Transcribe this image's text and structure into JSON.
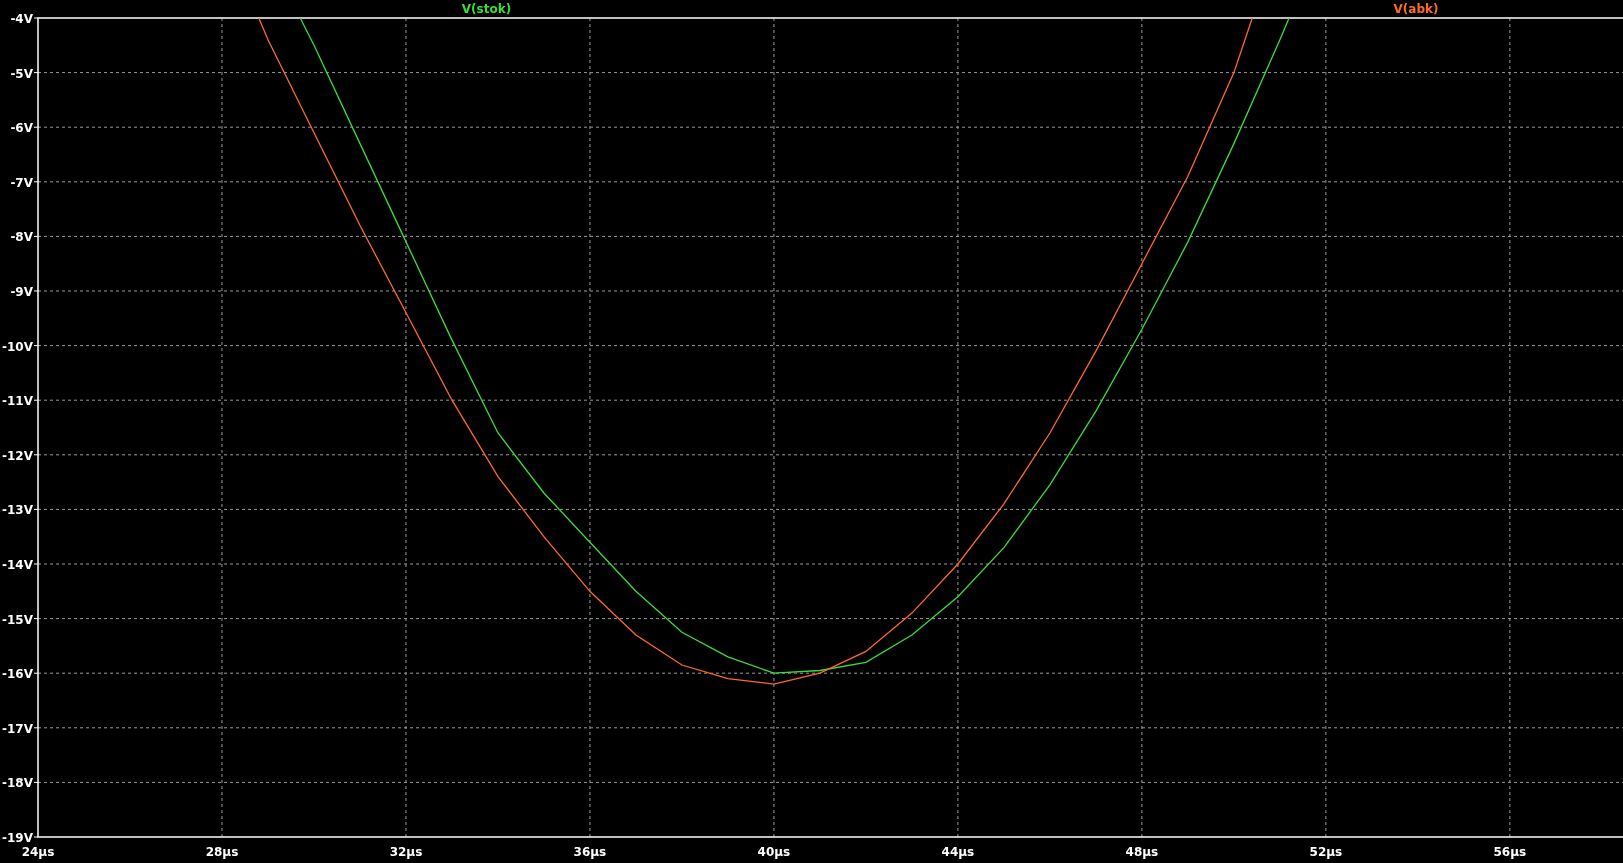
{
  "plot": {
    "chart_data": {
      "type": "line",
      "grid": true,
      "xlim": [
        24,
        58.46
      ],
      "ylim": [
        -19,
        -4
      ],
      "xticks": [
        {
          "value": 24,
          "label": "24µs"
        },
        {
          "value": 28,
          "label": "28µs"
        },
        {
          "value": 32,
          "label": "32µs"
        },
        {
          "value": 36,
          "label": "36µs"
        },
        {
          "value": 40,
          "label": "40µs"
        },
        {
          "value": 44,
          "label": "44µs"
        },
        {
          "value": 48,
          "label": "48µs"
        },
        {
          "value": 52,
          "label": "52µs"
        },
        {
          "value": 56,
          "label": "56µs"
        }
      ],
      "yticks": [
        {
          "value": -4,
          "label": "-4V"
        },
        {
          "value": -5,
          "label": "-5V"
        },
        {
          "value": -6,
          "label": "-6V"
        },
        {
          "value": -7,
          "label": "-7V"
        },
        {
          "value": -8,
          "label": "-8V"
        },
        {
          "value": -9,
          "label": "-9V"
        },
        {
          "value": -10,
          "label": "-10V"
        },
        {
          "value": -11,
          "label": "-11V"
        },
        {
          "value": -12,
          "label": "-12V"
        },
        {
          "value": -13,
          "label": "-13V"
        },
        {
          "value": -14,
          "label": "-14V"
        },
        {
          "value": -15,
          "label": "-15V"
        },
        {
          "value": -16,
          "label": "-16V"
        },
        {
          "value": -17,
          "label": "-17V"
        },
        {
          "value": -18,
          "label": "-18V"
        },
        {
          "value": -19,
          "label": "-19V"
        }
      ],
      "series": [
        {
          "name": "V(stok)",
          "color": "#3cdc3c",
          "x": [
            29.7,
            30,
            31,
            32,
            33,
            34,
            35,
            36,
            37,
            38,
            39,
            40,
            41,
            42,
            43,
            44,
            45,
            46,
            47,
            48,
            49,
            50,
            51,
            51.2
          ],
          "values": [
            -4,
            -4.5,
            -6.3,
            -8.1,
            -9.9,
            -11.6,
            -12.7,
            -13.6,
            -14.5,
            -15.25,
            -15.7,
            -16,
            -15.95,
            -15.8,
            -15.3,
            -14.6,
            -13.7,
            -12.55,
            -11.2,
            -9.7,
            -8.1,
            -6.3,
            -4.4,
            -4
          ]
        },
        {
          "name": "V(abk)",
          "color": "#ff6a2a",
          "x": [
            28.8,
            29,
            30,
            31,
            32,
            33,
            34,
            35,
            36,
            37,
            38,
            39,
            40,
            41,
            42,
            43,
            44,
            45,
            46,
            47,
            48,
            49,
            50,
            50.4
          ],
          "values": [
            -4,
            -4.4,
            -6.1,
            -7.8,
            -9.4,
            -11,
            -12.4,
            -13.5,
            -14.5,
            -15.3,
            -15.85,
            -16.1,
            -16.2,
            -16,
            -15.6,
            -14.9,
            -14,
            -12.9,
            -11.6,
            -10.1,
            -8.5,
            -6.9,
            -5,
            -4
          ]
        }
      ]
    }
  }
}
